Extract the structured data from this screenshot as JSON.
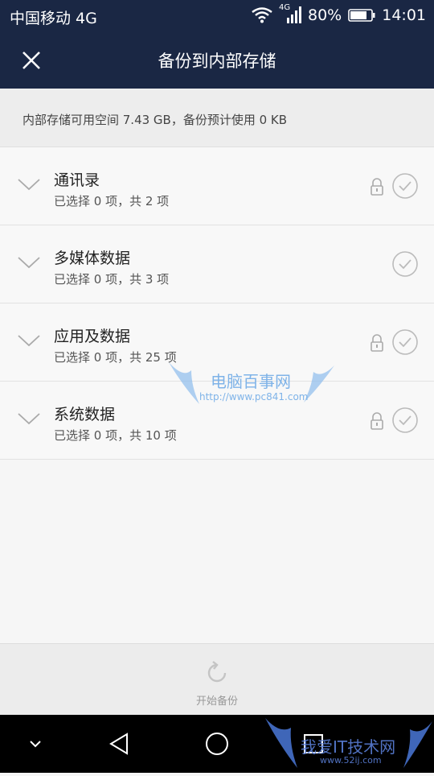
{
  "status_bar": {
    "carrier": "中国移动 4G",
    "network_badge": "4G",
    "battery_percent": "80%",
    "time": "14:01",
    "icons": [
      "wifi-icon",
      "signal-icon",
      "battery-icon"
    ]
  },
  "title_bar": {
    "title": "备份到内部存储",
    "close_icon": "close-icon"
  },
  "storage_info": {
    "text": "内部存储可用空间 7.43 GB，备份预计使用 0 KB"
  },
  "items": [
    {
      "name": "通讯录",
      "subtitle": "已选择 0 项，共 2 项",
      "locked": true
    },
    {
      "name": "多媒体数据",
      "subtitle": "已选择 0 项，共 3 项",
      "locked": false
    },
    {
      "name": "应用及数据",
      "subtitle": "已选择 0 项，共 25 项",
      "locked": true
    },
    {
      "name": "系统数据",
      "subtitle": "已选择 0 项，共 10 项",
      "locked": true
    }
  ],
  "action": {
    "start_backup_label": "开始备份",
    "icon": "refresh-icon"
  },
  "nav_bar": {
    "icons": [
      "chevron-down-icon",
      "back-icon",
      "home-icon",
      "recents-icon"
    ]
  },
  "watermarks": {
    "wm1_title": "电脑百事网",
    "wm1_url": "http://www.pc841.com",
    "wm2_title": "我爱IT技术网",
    "wm2_url": "www.52ij.com"
  },
  "colors": {
    "header_bg": "#1a2744",
    "list_bg": "#f8f8f8",
    "divider": "#e2e2e2",
    "icon_gray": "#b0b0b0"
  }
}
